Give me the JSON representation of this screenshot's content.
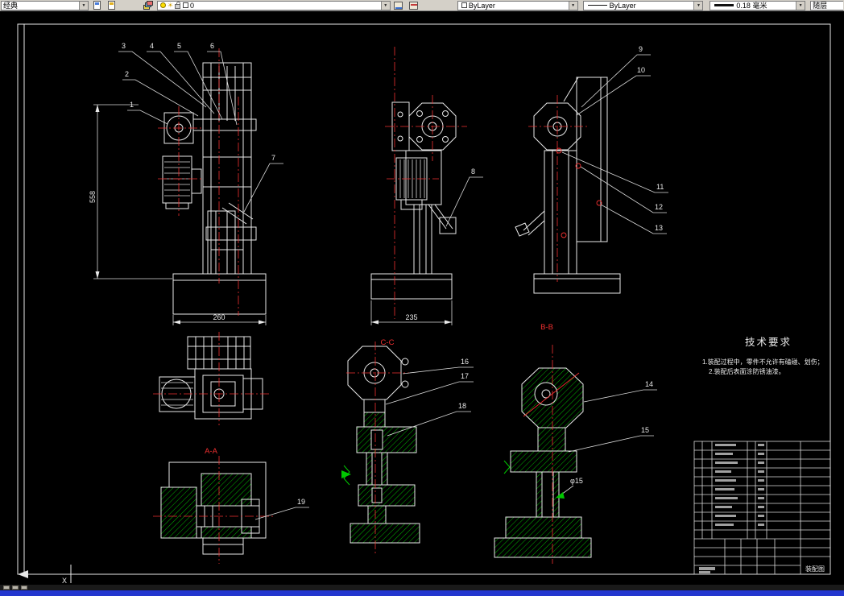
{
  "toolbar": {
    "workspace_value": "经典",
    "layer_name": "0",
    "color_value": "ByLayer",
    "linetype_value": "ByLayer",
    "lineweight_value": "0.18 毫米",
    "plotstyle_value": "随层"
  },
  "drawing": {
    "callouts": [
      "1",
      "2",
      "3",
      "4",
      "5",
      "6",
      "7",
      "8",
      "9",
      "10",
      "11",
      "12",
      "13",
      "14",
      "15",
      "16",
      "17",
      "18",
      "19"
    ],
    "dims": {
      "base_width_left": "260",
      "base_width_mid": "235",
      "height_left": "558",
      "column_dia": "φ15"
    },
    "sections": {
      "aa": "A-A",
      "cc": "C-C",
      "bb": "B-B"
    },
    "tech": {
      "title": "技术要求",
      "notes": [
        "1.装配过程中，零件不允许有磕碰、划伤；",
        "2.装配后表面涂防锈油漆。"
      ]
    },
    "titleblock": {
      "drawing_name": "装配图"
    }
  },
  "ucs": {
    "x_label": "X"
  }
}
